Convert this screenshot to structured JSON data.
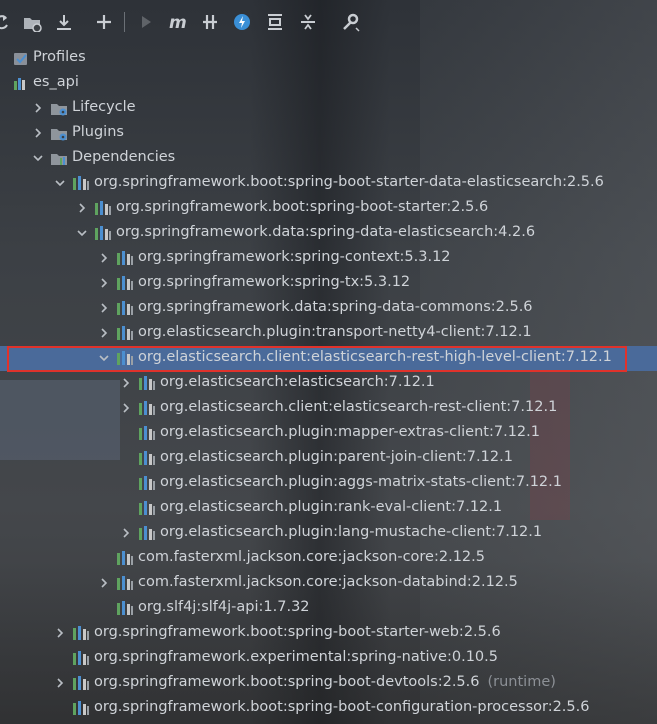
{
  "toolbar": {
    "items": [
      {
        "name": "refresh-icon"
      },
      {
        "name": "folder-refresh-icon"
      },
      {
        "name": "download-icon"
      },
      {
        "name": "add-icon"
      },
      {
        "name": "run-icon"
      },
      {
        "name": "maven-goal-icon",
        "glyph": "m"
      },
      {
        "name": "skip-tests-icon"
      },
      {
        "name": "offline-icon"
      },
      {
        "name": "show-dependencies-icon"
      },
      {
        "name": "collapse-all-icon"
      },
      {
        "name": "settings-wrench-icon"
      }
    ]
  },
  "tree": [
    {
      "label": "Profiles",
      "icon": "profiles-icon",
      "depth": 0,
      "chevron": "none"
    },
    {
      "label": "es_api",
      "icon": "module-icon",
      "depth": 0,
      "chevron": "none"
    },
    {
      "label": "Lifecycle",
      "icon": "folder-gear-icon",
      "depth": 1,
      "chevron": "right"
    },
    {
      "label": "Plugins",
      "icon": "folder-gear-icon",
      "depth": 1,
      "chevron": "right"
    },
    {
      "label": "Dependencies",
      "icon": "folder-library-icon",
      "depth": 1,
      "chevron": "down"
    },
    {
      "label": "org.springframework.boot:spring-boot-starter-data-elasticsearch:2.5.6",
      "icon": "library-icon",
      "depth": 2,
      "chevron": "down"
    },
    {
      "label": "org.springframework.boot:spring-boot-starter:2.5.6",
      "icon": "library-icon",
      "depth": 3,
      "chevron": "right"
    },
    {
      "label": "org.springframework.data:spring-data-elasticsearch:4.2.6",
      "icon": "library-icon",
      "depth": 3,
      "chevron": "down"
    },
    {
      "label": "org.springframework:spring-context:5.3.12",
      "icon": "library-icon",
      "depth": 4,
      "chevron": "right"
    },
    {
      "label": "org.springframework:spring-tx:5.3.12",
      "icon": "library-icon",
      "depth": 4,
      "chevron": "right"
    },
    {
      "label": "org.springframework.data:spring-data-commons:2.5.6",
      "icon": "library-icon",
      "depth": 4,
      "chevron": "right"
    },
    {
      "label": "org.elasticsearch.plugin:transport-netty4-client:7.12.1",
      "icon": "library-icon",
      "depth": 4,
      "chevron": "right"
    },
    {
      "label": "org.elasticsearch.client:elasticsearch-rest-high-level-client:7.12.1",
      "icon": "library-icon",
      "depth": 4,
      "chevron": "down",
      "selected": true
    },
    {
      "label": "org.elasticsearch:elasticsearch:7.12.1",
      "icon": "library-icon",
      "depth": 5,
      "chevron": "right"
    },
    {
      "label": "org.elasticsearch.client:elasticsearch-rest-client:7.12.1",
      "icon": "library-icon",
      "depth": 5,
      "chevron": "right"
    },
    {
      "label": "org.elasticsearch.plugin:mapper-extras-client:7.12.1",
      "icon": "library-icon",
      "depth": 5,
      "chevron": "none"
    },
    {
      "label": "org.elasticsearch.plugin:parent-join-client:7.12.1",
      "icon": "library-icon",
      "depth": 5,
      "chevron": "none"
    },
    {
      "label": "org.elasticsearch.plugin:aggs-matrix-stats-client:7.12.1",
      "icon": "library-icon",
      "depth": 5,
      "chevron": "none"
    },
    {
      "label": "org.elasticsearch.plugin:rank-eval-client:7.12.1",
      "icon": "library-icon",
      "depth": 5,
      "chevron": "none"
    },
    {
      "label": "org.elasticsearch.plugin:lang-mustache-client:7.12.1",
      "icon": "library-icon",
      "depth": 5,
      "chevron": "right"
    },
    {
      "label": "com.fasterxml.jackson.core:jackson-core:2.12.5",
      "icon": "library-icon",
      "depth": 4,
      "chevron": "none"
    },
    {
      "label": "com.fasterxml.jackson.core:jackson-databind:2.12.5",
      "icon": "library-icon",
      "depth": 4,
      "chevron": "right"
    },
    {
      "label": "org.slf4j:slf4j-api:1.7.32",
      "icon": "library-icon",
      "depth": 4,
      "chevron": "none"
    },
    {
      "label": "org.springframework.boot:spring-boot-starter-web:2.5.6",
      "icon": "library-icon",
      "depth": 2,
      "chevron": "right"
    },
    {
      "label": "org.springframework.experimental:spring-native:0.10.5",
      "icon": "library-icon",
      "depth": 2,
      "chevron": "none"
    },
    {
      "label": "org.springframework.boot:spring-boot-devtools:2.5.6",
      "icon": "library-icon",
      "depth": 2,
      "chevron": "right",
      "suffix": "(runtime)"
    },
    {
      "label": "org.springframework.boot:spring-boot-configuration-processor:2.5.6",
      "icon": "library-icon",
      "depth": 2,
      "chevron": "none"
    }
  ],
  "colors": {
    "selection": "#4a6a9a",
    "highlight_border": "#e0322b",
    "library_bars": [
      "#5fa35f",
      "#4c8fd0",
      "#c8c8c8"
    ]
  }
}
